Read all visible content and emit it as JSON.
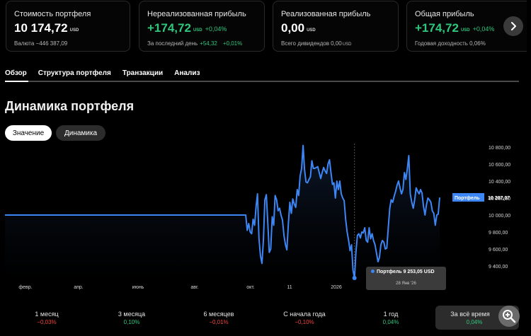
{
  "cards": [
    {
      "label": "Стоимость портфеля",
      "value": "10 174,72",
      "currency": "USD",
      "pct": "",
      "sub_text": "Валюта −446 387,09",
      "sub_green": "",
      "sub_green2": "",
      "sub_unit": ""
    },
    {
      "label": "Нереализованная прибыль",
      "value": "+174,72",
      "currency": "USD",
      "pct": "+0,04%",
      "sub_text": "За последний день",
      "sub_green": "+54,32",
      "sub_green2": "+0,01%",
      "sub_unit": ""
    },
    {
      "label": "Реализованная прибыль",
      "value": "0,00",
      "currency": "USD",
      "pct": "",
      "sub_text": "Всего дивидендов 0,00",
      "sub_green": "",
      "sub_green2": "",
      "sub_unit": "USD"
    },
    {
      "label": "Общая прибыль",
      "value": "+174,72",
      "currency": "USD",
      "pct": "+0,04%",
      "sub_text": "Годовая доходность 0,06%",
      "sub_green": "",
      "sub_green2": "",
      "sub_unit": ""
    }
  ],
  "tabs": [
    "Обзор",
    "Структура портфеля",
    "Транзакции",
    "Анализ"
  ],
  "title": "Динамика портфеля",
  "toggle": {
    "active": "Значение",
    "inactive": "Динамика"
  },
  "chart_data": {
    "type": "line",
    "series": [
      {
        "name": "Портфель",
        "current_value": "10 207,07"
      }
    ],
    "x_ticks": [
      "февр.",
      "апр.",
      "июнь",
      "авг.",
      "окт.",
      "11",
      "2026"
    ],
    "y_ticks": [
      "10 800,00",
      "10 600,00",
      "10 400,00",
      "10 200,00",
      "10 000,00",
      "9 800,00",
      "9 600,00",
      "9 400,00"
    ],
    "ylim": [
      9250,
      10850
    ],
    "flat_value": 10000,
    "points": [
      10000,
      10000,
      10000,
      9820,
      9900,
      9800,
      9780,
      9950,
      9880,
      10100,
      10250,
      9720,
      9520,
      9430,
      9700,
      10180,
      10240,
      9900,
      9560,
      9600,
      9980,
      9880,
      10230,
      10180,
      10050,
      10080,
      10000,
      9940,
      9760,
      9650,
      9590,
      9900,
      10150,
      10020,
      10190,
      10130,
      10090,
      10300,
      10230,
      10460,
      10550,
      10820,
      10540,
      10390,
      10380,
      10420,
      10450,
      10640,
      10550,
      10550,
      10560,
      10570,
      10500,
      10430,
      10500,
      10560,
      10520,
      10490,
      10600,
      10650,
      10500,
      10360,
      10380,
      10200,
      10400,
      10300,
      10400,
      10250,
      10200,
      10170,
      9950,
      9800,
      9700,
      9580,
      9650,
      9350,
      9253,
      9560,
      9760,
      9780,
      9730,
      9800,
      9790,
      9850,
      9700,
      9680,
      9850,
      9720,
      9780,
      9700,
      9650,
      9550,
      9450,
      9500,
      9650,
      9700,
      9680,
      9600,
      9610,
      9850,
      10080,
      10180,
      10150,
      10220,
      10280,
      10350,
      10400,
      10320,
      10250,
      10300,
      10500,
      10420,
      10550,
      10700,
      10250,
      10150,
      10080,
      10180,
      10320,
      10280,
      10250,
      10300,
      10260,
      10100,
      10000,
      10120,
      10200,
      10180,
      10150,
      10050,
      10020,
      9880,
      10000,
      10010,
      10207
    ],
    "tooltip": {
      "series": "Портфель",
      "value": "9 253,05",
      "currency": "USD",
      "date": "28 Янв '26"
    }
  },
  "periods": [
    {
      "label": "1 месяц",
      "value": "−0,03%",
      "color": "red"
    },
    {
      "label": "3 месяца",
      "value": "0,10%",
      "color": "green"
    },
    {
      "label": "6 месяцев",
      "value": "−0,01%",
      "color": "red"
    },
    {
      "label": "С начала года",
      "value": "−0,10%",
      "color": "red"
    },
    {
      "label": "1 год",
      "value": "0,04%",
      "color": "green"
    },
    {
      "label": "За всё время",
      "value": "0,04%",
      "color": "green"
    }
  ],
  "icons": {
    "next": "chevron-right-icon",
    "zoom": "zoom-in-icon"
  },
  "colors": {
    "line": "#3d86f5",
    "positive": "#2fc77d",
    "negative": "#f0453a"
  }
}
